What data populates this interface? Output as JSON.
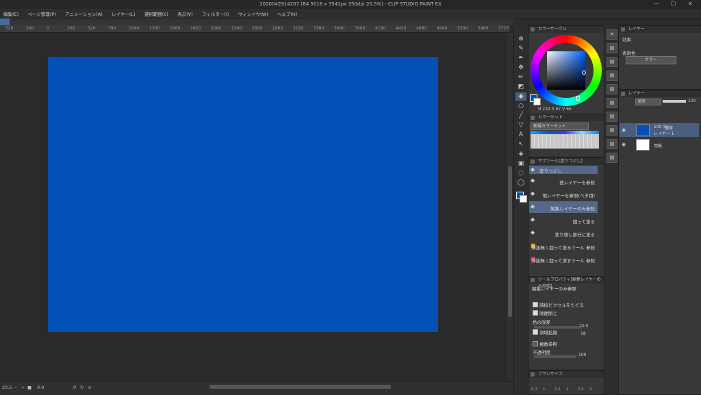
{
  "window": {
    "title": "2020042914207 (B4 5016 x 3541px 350dpi 20.5%) - CLIP STUDIO PAINT EX",
    "controls": {
      "minimize": "—",
      "maximize": "☐",
      "close": "✕"
    }
  },
  "menu": [
    "編集(E)",
    "ページ管理(P)",
    "アニメーション(A)",
    "レイヤー(L)",
    "選択範囲(S)",
    "表示(V)",
    "フィルター(I)",
    "ウィンドウ(W)",
    "ヘルプ(H)"
  ],
  "ruler": [
    "520",
    "260",
    "0",
    "260",
    "520",
    "780",
    "1040",
    "1300",
    "1560",
    "1820",
    "2080",
    "2340",
    "2600",
    "2860",
    "3120",
    "3380",
    "3640",
    "3900",
    "4160",
    "4420",
    "4680",
    "4940",
    "5200",
    "5460",
    "5720"
  ],
  "canvas": {
    "paper_color": "#0050b5",
    "background": "#2a2a2a"
  },
  "status": {
    "zoom": "20.5",
    "rotation": "0.0"
  },
  "toolbar": {
    "tools": [
      "zoom-icon",
      "pen-icon",
      "eyedropper-icon",
      "move-icon",
      "brush-icon",
      "eraser-icon",
      "fill-icon",
      "ellipse-icon",
      "line-icon",
      "pen-nib-icon",
      "text-icon",
      "operation-icon",
      "gradient-icon",
      "frame-icon",
      "balloon-icon",
      "lasso-icon"
    ],
    "fg_color": "#0050b5",
    "bg_color": "#ffffff"
  },
  "color_wheel": {
    "title": "カラーサークル",
    "h": "219",
    "s": "97",
    "v": "66"
  },
  "color_set": {
    "title": "カラーセット",
    "name": "新規カラーセット"
  },
  "subtool": {
    "title": "サブツール[塗りつぶし]",
    "tab_label": "塗りつぶし",
    "items": [
      {
        "label": "他レイヤーを参照",
        "icon": "fill-icon"
      },
      {
        "label": "他レイヤーを参照(ベタ用)",
        "icon": "fill-icon"
      },
      {
        "label": "編集レイヤーのみ参照",
        "icon": "fill-icon"
      },
      {
        "label": "囲って塗る",
        "icon": "fill-icon"
      },
      {
        "label": "塗り残し部分に塗る",
        "icon": "brush-stroke-icon"
      },
      {
        "label": "隣接無く囲って塗るツール 参照",
        "icon": "color-icon"
      },
      {
        "label": "隣接無く囲って消すツール 参照",
        "icon": "color-icon"
      }
    ]
  },
  "tool_property": {
    "title": "ツールプロパティ[編集レイヤーのみ参照]",
    "heading": "編集レイヤーのみ参照",
    "rows": {
      "adjacent": "隣接ピクセルをたどる",
      "close_gap": "隙間閉じ",
      "color_margin": "色の誤差",
      "color_margin_value": "70.0",
      "area_scaling": "領域拡縮",
      "area_scaling_value": "18",
      "multi_ref": "複数参照",
      "opacity": "不透明度",
      "opacity_value": "100"
    }
  },
  "brush_size": {
    "title": "ブラシサイズ",
    "values": [
      "0.7",
      "1",
      "1.5",
      "2",
      "2.5",
      "3"
    ]
  },
  "effects": {
    "title": "効果",
    "expression_color": "表現色",
    "color_mode": "カラー"
  },
  "layers": {
    "title": "レイヤー",
    "blend_mode": "通常",
    "opacity": "100",
    "items": [
      {
        "percent": "100 %",
        "mode": "通常",
        "name": "レイヤー 1",
        "color": "#0050b5",
        "selected": true
      },
      {
        "name": "用紙",
        "color": "#ffffff",
        "selected": false
      }
    ]
  }
}
